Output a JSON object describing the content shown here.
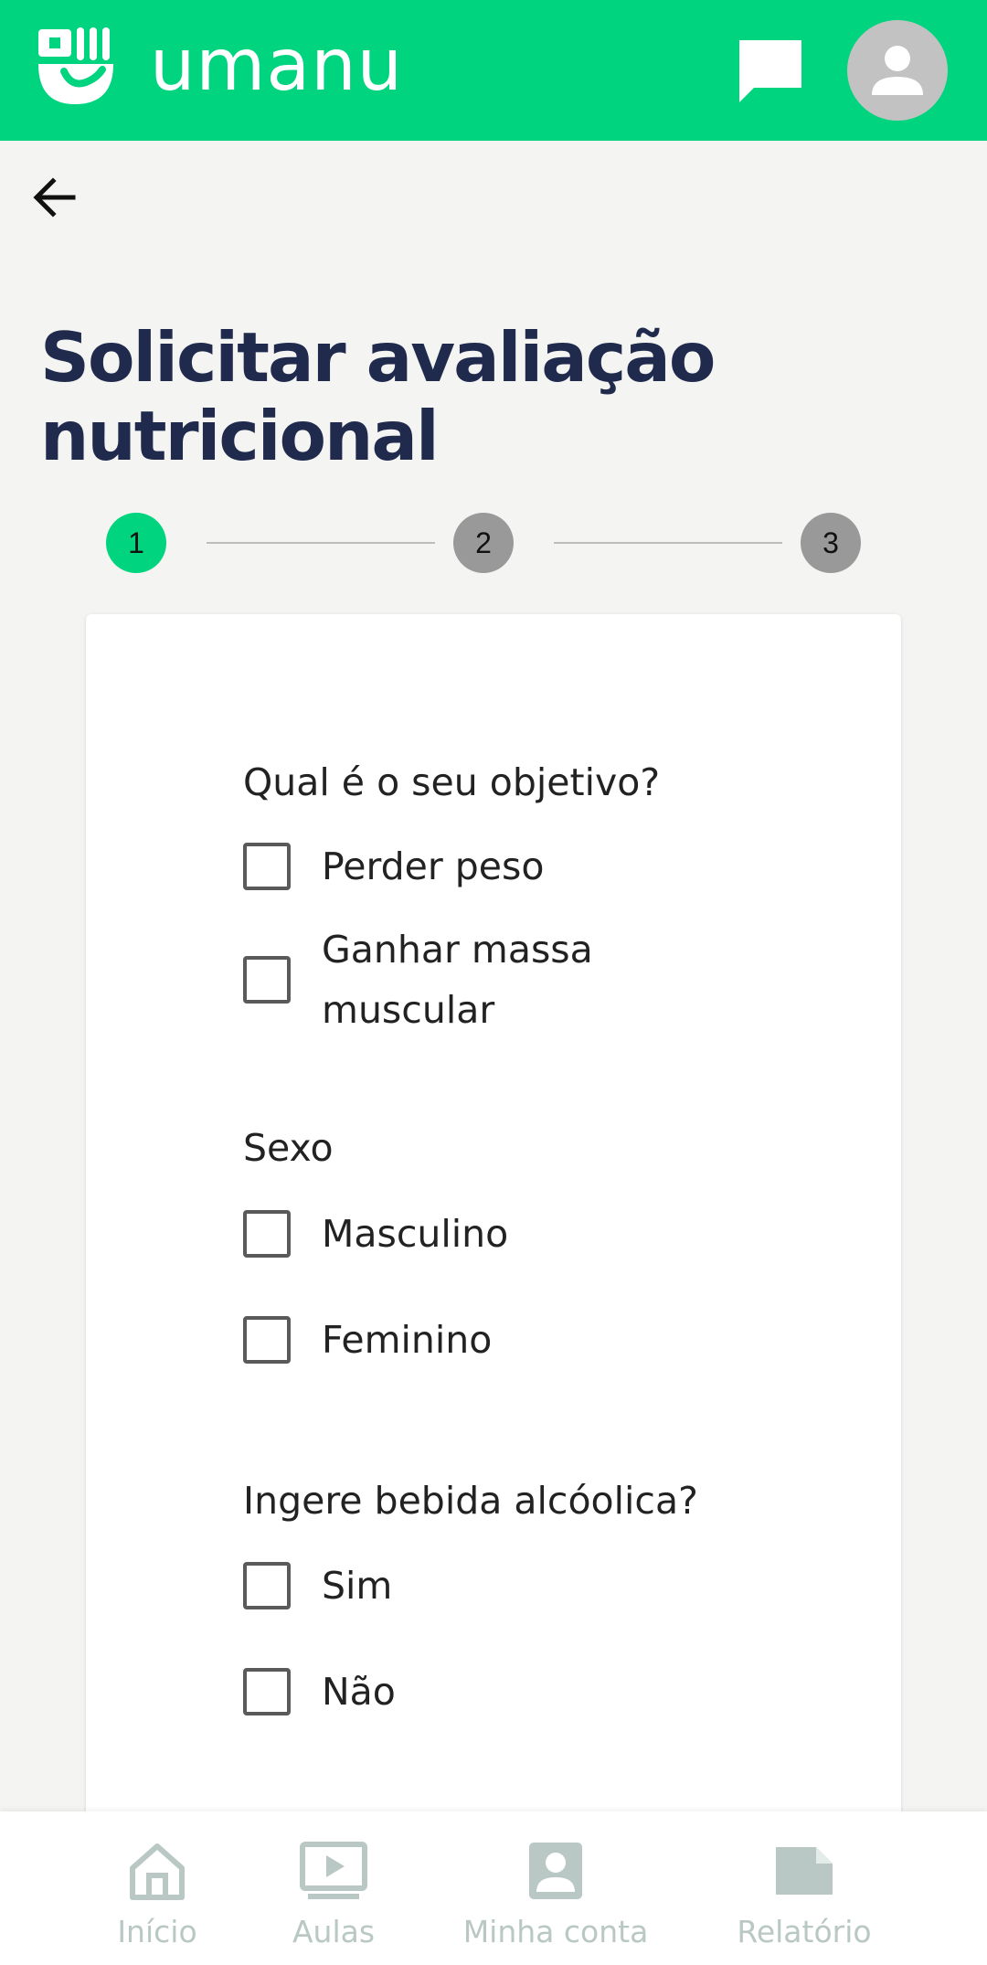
{
  "header": {
    "app_name": "umanu",
    "brand_color": "#00d47e",
    "chat_icon": "chat-bubble-icon",
    "avatar_icon": "person-icon"
  },
  "page": {
    "back_icon": "arrow-left-icon",
    "title": "Solicitar avaliação nutricional"
  },
  "stepper": {
    "steps": [
      "1",
      "2",
      "3"
    ],
    "current": 1
  },
  "form": {
    "q1": {
      "label": "Qual é o seu objetivo?",
      "options": [
        {
          "label": "Perder peso",
          "checked": false
        },
        {
          "label": "Ganhar massa muscular",
          "checked": false
        }
      ]
    },
    "q2": {
      "label": "Sexo",
      "options": [
        {
          "label": "Masculino",
          "checked": false
        },
        {
          "label": "Feminino",
          "checked": false
        }
      ]
    },
    "q3": {
      "label": "Ingere bebida alcóolica?",
      "options": [
        {
          "label": "Sim",
          "checked": false
        },
        {
          "label": "Não",
          "checked": false
        }
      ]
    }
  },
  "bottom_nav": {
    "items": [
      {
        "label": "Início",
        "icon": "home-icon"
      },
      {
        "label": "Aulas",
        "icon": "play-video-icon"
      },
      {
        "label": "Minha conta",
        "icon": "account-icon"
      },
      {
        "label": "Relatório",
        "icon": "report-icon"
      }
    ],
    "color": "#b9c8c4"
  }
}
